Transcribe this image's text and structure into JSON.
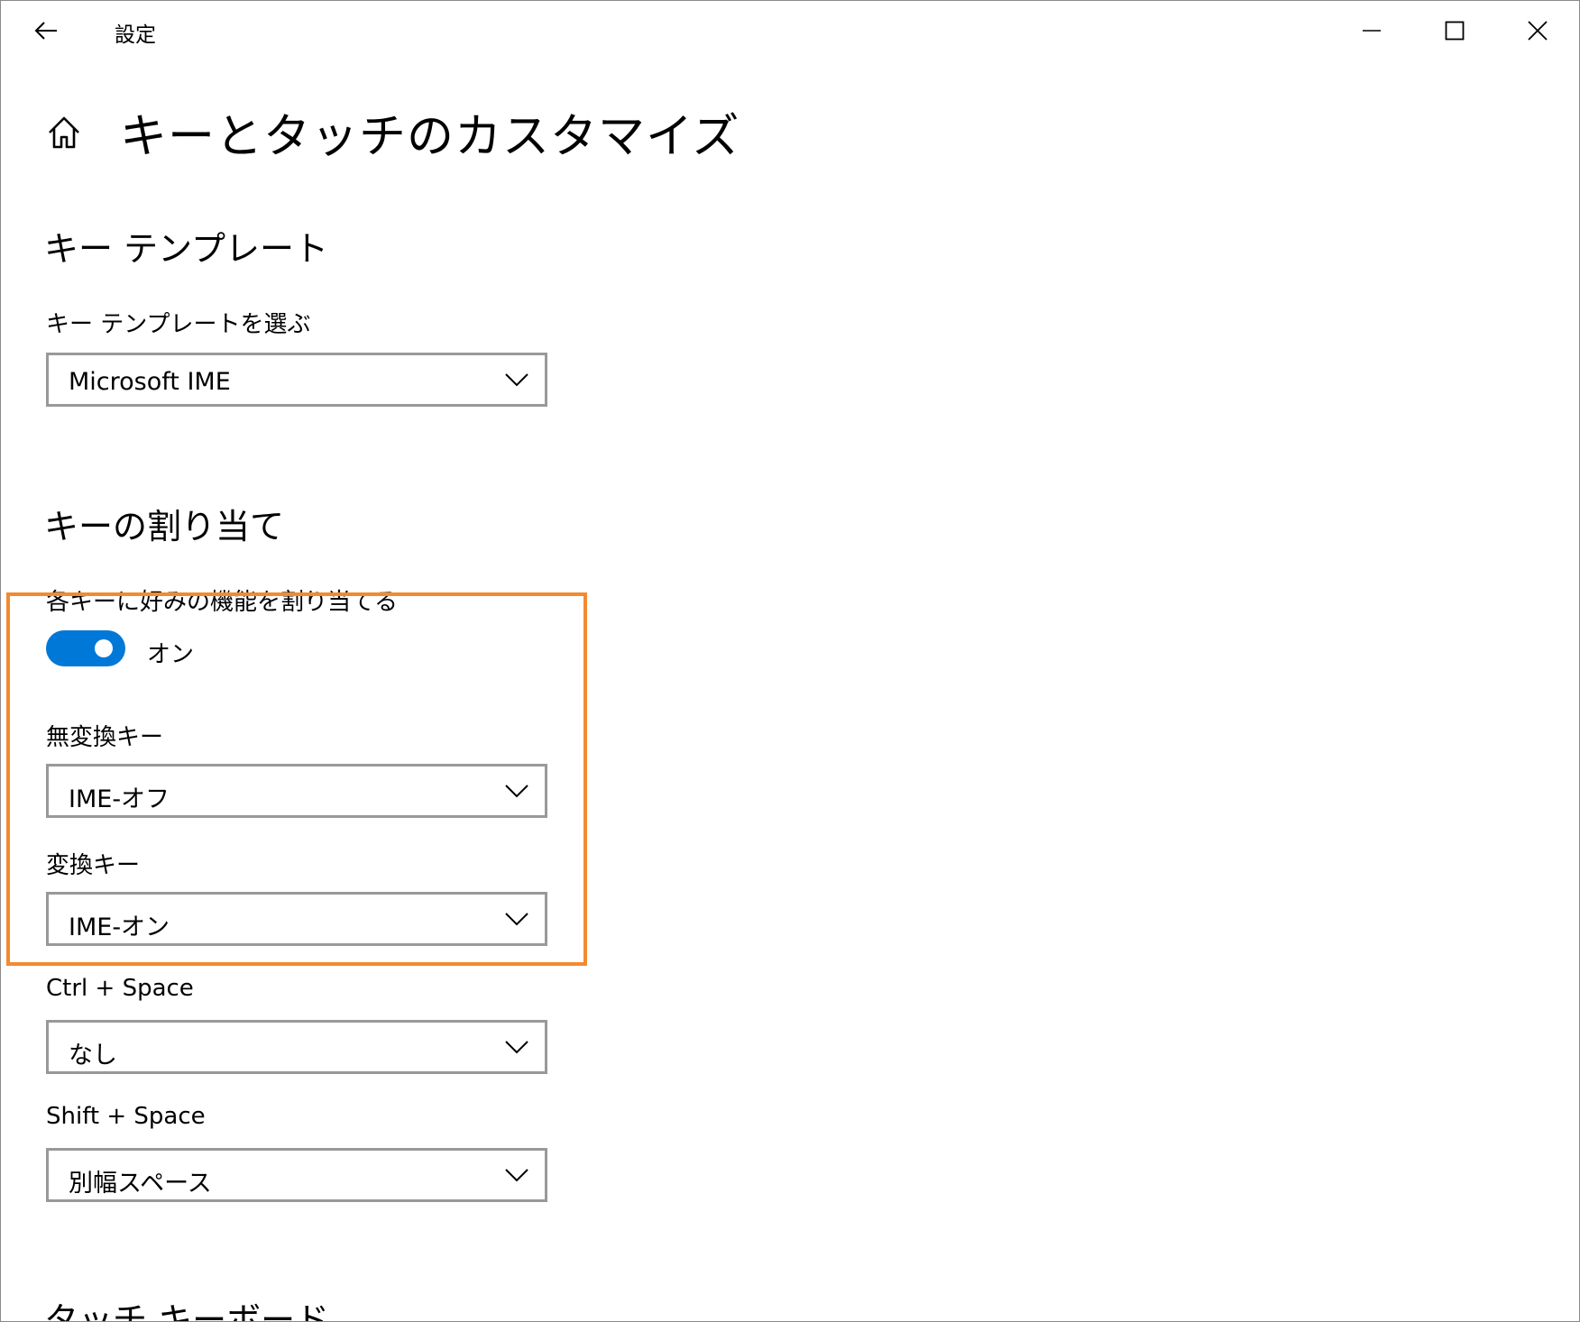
{
  "titlebar": {
    "title": "設定",
    "back_icon": "arrow-left-icon",
    "minimize_icon": "minimize-icon",
    "maximize_icon": "maximize-icon",
    "close_icon": "close-icon"
  },
  "page": {
    "home_icon": "home-icon",
    "title": "キーとタッチのカスタマイズ"
  },
  "key_template": {
    "heading": "キー テンプレート",
    "label": "キー テンプレートを選ぶ",
    "value": "Microsoft IME"
  },
  "key_assignment": {
    "heading": "キーの割り当て",
    "toggle_label": "各キーに好みの機能を割り当てる",
    "toggle_state": "オン",
    "toggle_on": true,
    "fields": [
      {
        "label": "無変換キー",
        "value": "IME-オフ"
      },
      {
        "label": "変換キー",
        "value": "IME-オン"
      },
      {
        "label": "Ctrl + Space",
        "value": "なし"
      },
      {
        "label": "Shift + Space",
        "value": "別幅スペース"
      }
    ]
  },
  "touch_keyboard": {
    "heading": "タッチ キーボード"
  },
  "colors": {
    "accent": "#0078d7",
    "highlight": "#f28a30",
    "dropdown_border": "#999999"
  }
}
